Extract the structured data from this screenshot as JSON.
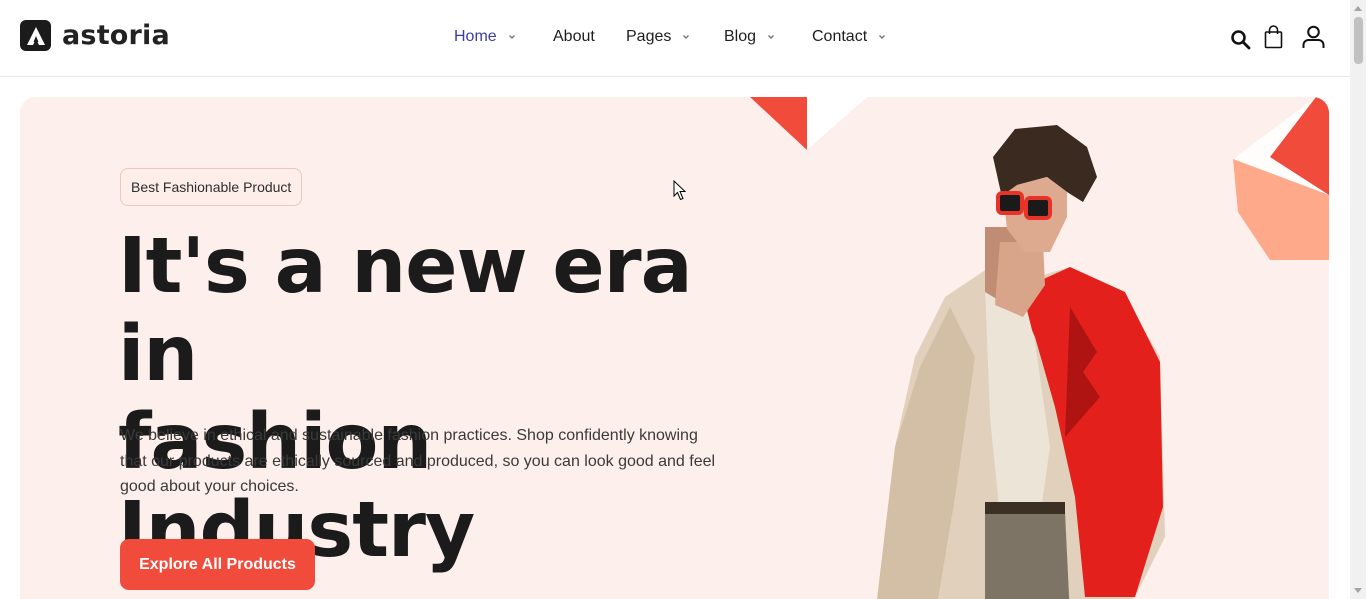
{
  "brand": {
    "name": "astoria"
  },
  "nav": {
    "items": [
      {
        "label": "Home",
        "has_dropdown": true,
        "active": true
      },
      {
        "label": "About",
        "has_dropdown": false,
        "active": false
      },
      {
        "label": "Pages",
        "has_dropdown": true,
        "active": false
      },
      {
        "label": "Blog",
        "has_dropdown": true,
        "active": false
      },
      {
        "label": "Contact",
        "has_dropdown": true,
        "active": false
      }
    ]
  },
  "header_icons": [
    "search-icon",
    "shopping-bag-icon",
    "user-icon"
  ],
  "hero": {
    "badge": "Best Fashionable Product",
    "title_line1": "It's a new era in",
    "title_line2": "fashion Industry",
    "description": "We believe in ethical and sustainable fashion practices. Shop confidently knowing that our products are ethically sourced and produced, so you can look good and feel good about your choices.",
    "cta_label": "Explore All Products"
  },
  "colors": {
    "accent": "#f04b3b",
    "nav_active": "#3b3fa3",
    "hero_bg": "#fdefeb",
    "deco_peach": "#fea98a"
  }
}
